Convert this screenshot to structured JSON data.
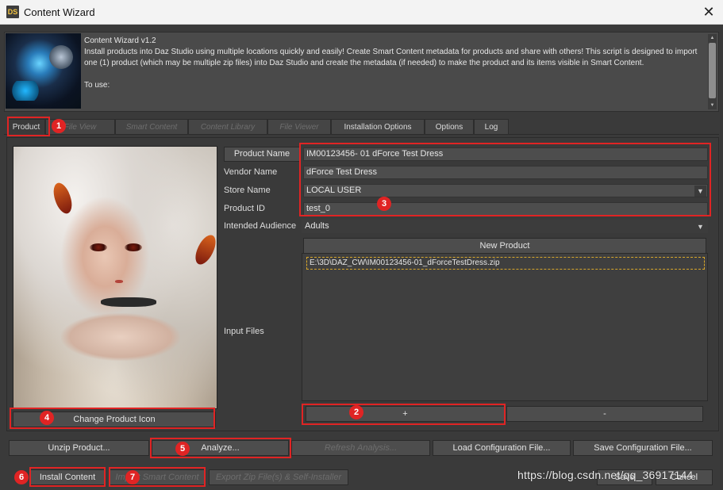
{
  "window": {
    "icon_text": "DS",
    "title": "Content Wizard",
    "close_glyph": "✕"
  },
  "intro": {
    "lines": [
      "Content Wizard v1.2",
      "Install products into Daz Studio using multiple locations quickly and easily!  Create Smart Content metadata for products and share with others!  This script is designed to import one (1) product (which may be multiple zip files) into Daz Studio and create the metadata (if needed) to make the product and its items visible in Smart Content.",
      "To use:"
    ]
  },
  "tabs": [
    {
      "label": "Product",
      "state": "active"
    },
    {
      "label": "File View",
      "state": "disabled"
    },
    {
      "label": "Smart Content",
      "state": "disabled"
    },
    {
      "label": "Content Library",
      "state": "disabled"
    },
    {
      "label": "File Viewer",
      "state": "disabled"
    },
    {
      "label": "Installation Options",
      "state": "enabled"
    },
    {
      "label": "Options",
      "state": "enabled"
    },
    {
      "label": "Log",
      "state": "enabled"
    }
  ],
  "product": {
    "change_icon_label": "Change Product Icon",
    "product_name_button": "Product Name",
    "product_name_value": "IM00123456- 01 dForce Test Dress",
    "vendor_name_label": "Vendor Name",
    "vendor_name_value": "dForce Test Dress",
    "store_name_label": "Store Name",
    "store_name_value": "LOCAL USER",
    "product_id_label": "Product ID",
    "product_id_value": "test_0",
    "audience_label": "Intended Audience",
    "audience_value": "Adults",
    "new_product_label": "New Product",
    "input_files_label": "Input Files",
    "input_files": [
      "E:\\3D\\DAZ_CW\\IM00123456-01_dForceTestDress.zip"
    ],
    "add_file_label": "+",
    "remove_file_label": "-"
  },
  "actions": {
    "unzip": "Unzip Product...",
    "analyze": "Analyze...",
    "refresh": "Refresh Analysis...",
    "load_config": "Load Configuration File...",
    "save_config": "Save Configuration File..."
  },
  "footer": {
    "install_content": "Install Content",
    "import_smart": "Import Smart Content",
    "export_zip": "Export Zip File(s) & Self-Installer",
    "save": "Save",
    "cancel": "Cancel"
  },
  "annotations": [
    "1",
    "2",
    "3",
    "4",
    "5",
    "6",
    "7"
  ],
  "watermark": "https://blog.csdn.net/qq_36917144",
  "colors": {
    "background": "#3a3a3a",
    "annotation": "#e02424",
    "file_highlight": "#d9a72a"
  }
}
